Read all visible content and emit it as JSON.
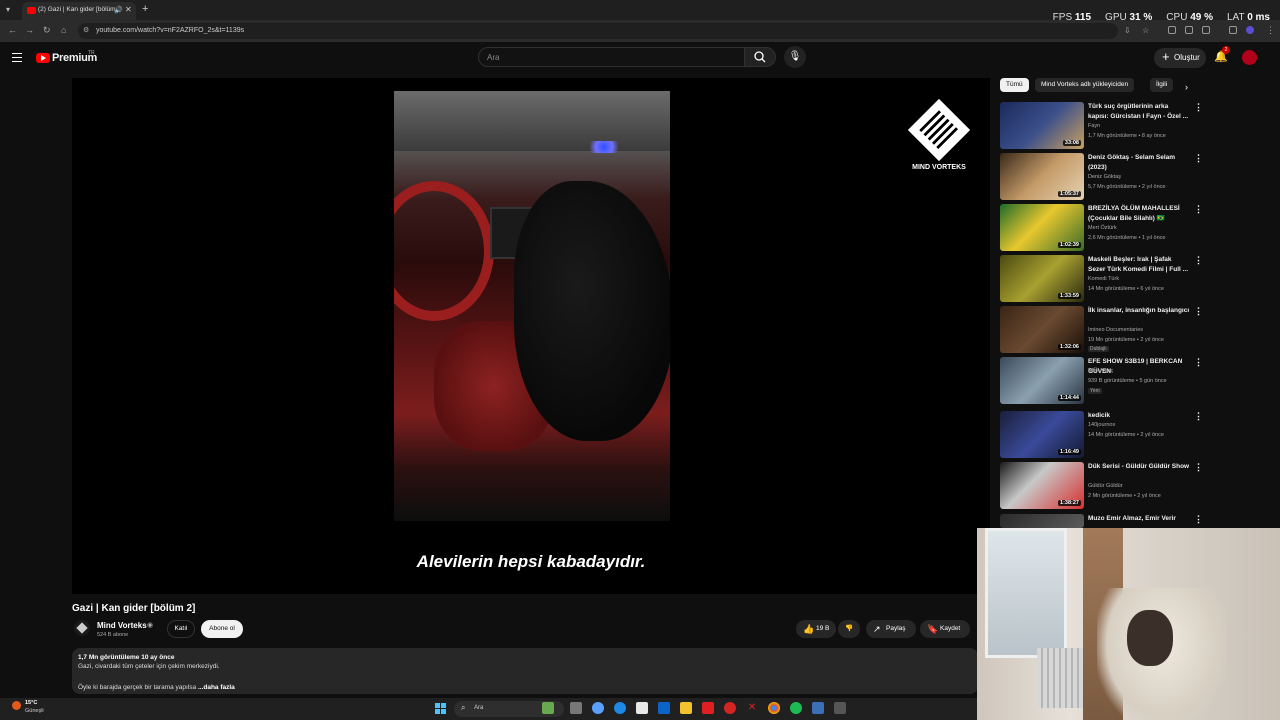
{
  "browser": {
    "tab_title": "(2) Gazi | Kan gider [bölüm",
    "url": "youtube.com/watch?v=nF2AZRFO_2s&t=1139s"
  },
  "overlay": {
    "fps_label": "FPS",
    "fps_value": "115",
    "gpu_label": "GPU",
    "gpu_value": "31 %",
    "cpu_label": "CPU",
    "cpu_value": "49 %",
    "lat_label": "LAT",
    "lat_value": "0 ms"
  },
  "header": {
    "logo_text": "Premium",
    "country": "TR",
    "search_placeholder": "Ara",
    "create_label": "Oluştur",
    "notification_count": "2"
  },
  "player": {
    "subtitle": "Alevilerin hepsi kabadayıdır.",
    "watermark_text": "MIND VORTEKS"
  },
  "video": {
    "title": "Gazi | Kan gider [bölüm 2]",
    "channel_name": "Mind Vorteks",
    "subscribers": "524 B abone",
    "join_label": "Katıl",
    "subscribe_label": "Abone ol",
    "likes": "19 B",
    "share_label": "Paylaş",
    "save_label": "Kaydet",
    "description_meta": "1,7 Mn görüntüleme  10 ay önce",
    "description_line1": "Gazi, civardaki tüm çeteler için çekim merkeziydi.",
    "description_line2": "Öyle ki barajda gerçek bir tarama yapılsa",
    "description_more": "...daha fazla"
  },
  "chips": [
    "Tümü",
    "Mind Vorteks adlı yükleyiciden",
    "İlgili"
  ],
  "recommendations": [
    {
      "title": "Türk suç örgütlerinin arka kapısı: Gürcistan l Fayn - Özel ...",
      "channel": "Fayn",
      "meta": "1,7 Mn görüntüleme • 8 ay önce",
      "duration": "33:08",
      "badge": ""
    },
    {
      "title": "Deniz Göktaş - Selam Selam (2023)",
      "channel": "Deniz Göktaş",
      "meta": "5,7 Mn görüntüleme • 2 yıl önce",
      "duration": "1:05:37",
      "badge": ""
    },
    {
      "title": "BREZİLYA ÖLÜM MAHALLESİ (Çocuklar Bile Silahlı) 🇧🇷",
      "channel": "Mert Öztürk",
      "meta": "2,6 Mn görüntüleme • 1 yıl önce",
      "duration": "1:02:39",
      "badge": ""
    },
    {
      "title": "Maskeli Beşler: Irak | Şafak Sezer Türk Komedi Filmi | Full ...",
      "channel": "Komedi Türk",
      "meta": "14 Mn görüntüleme • 6 yıl önce",
      "duration": "1:33:59",
      "badge": ""
    },
    {
      "title": "İlk insanlar, insanlığın başlangıcı",
      "channel": "Imineo Documentaries",
      "meta": "19 Mn görüntüleme • 2 yıl önce",
      "duration": "1:32:06",
      "badge": "Dublajlı"
    },
    {
      "title": "EFE SHOW S3B19 | BERKCAN GÜVEN",
      "channel": "Efe Uygaç",
      "meta": "939 B görüntüleme • 5 gün önce",
      "duration": "1:14:44",
      "badge": "Yeni"
    },
    {
      "title": "kedicik",
      "channel": "140journos",
      "meta": "14 Mn görüntüleme • 2 yıl önce",
      "duration": "1:16:49",
      "badge": ""
    },
    {
      "title": "Dük Serisi - Güldür Güldür Show",
      "channel": "Güldür Güldür",
      "meta": "2 Mn görüntüleme • 2 yıl önce",
      "duration": "1:38:27",
      "badge": ""
    },
    {
      "title": "Muzo Emir Almaz, Emir Verir",
      "channel": "",
      "meta": "",
      "duration": "",
      "badge": ""
    }
  ],
  "taskbar": {
    "weather_temp": "15°C",
    "weather_desc": "Güneşli",
    "search_placeholder": "Ara"
  }
}
